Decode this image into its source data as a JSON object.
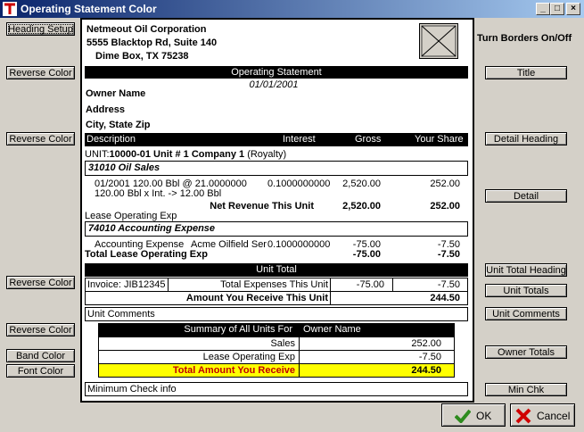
{
  "window": {
    "title": "Operating Statement Color"
  },
  "left_buttons": {
    "heading_setup": "Heading Setup",
    "reverse_color_1": "Reverse Color",
    "reverse_color_2": "Reverse Color",
    "reverse_color_3": "Reverse Color",
    "reverse_color_4": "Reverse Color",
    "band_color": "Band Color",
    "font_color": "Font Color"
  },
  "right_panel": {
    "heading": "Turn Borders On/Off",
    "title": "Title",
    "detail_heading": "Detail Heading",
    "detail": "Detail",
    "unit_total_heading": "Unit Total Heading",
    "unit_totals": "Unit Totals",
    "unit_comments": "Unit Comments",
    "owner_totals": "Owner Totals",
    "min_chk": "Min Chk"
  },
  "company": {
    "name": "Netmeout Oil Corporation",
    "address1": "5555 Blacktop Rd, Suite 140",
    "address2": "Dime Box, TX  75238"
  },
  "statement": {
    "title": "Operating Statement",
    "date": "01/01/2001"
  },
  "owner": {
    "name": "Owner Name",
    "address": "Address",
    "city": "City, State Zip"
  },
  "detail_header": {
    "description": "Description",
    "interest": "Interest",
    "gross": "Gross",
    "share": "Your Share"
  },
  "unit_line": {
    "prefix": "UNIT:",
    "name": "10000-01 Unit # 1 Company 1",
    "suffix": "(Royalty)"
  },
  "oil_sales": {
    "header": "31010 Oil Sales",
    "line1_desc": "01/2001  120.00 Bbl @ 21.0000000",
    "line1_interest": "0.1000000000",
    "line1_gross": "2,520.00",
    "line1_share": "252.00",
    "line2_desc": "120.00 Bbl x Int. -> 12.00 Bbl",
    "net_label": "Net Revenue This Unit",
    "net_gross": "2,520.00",
    "net_share": "252.00"
  },
  "lease_exp": {
    "label": "Lease Operating Exp",
    "header": "74010 Accounting Expense",
    "line1_desc": "Accounting Expense",
    "line1_vendor": "Acme Oilfield Ser",
    "line1_interest": "0.1000000000",
    "line1_gross": "-75.00",
    "line1_share": "-7.50",
    "total_label": "Total Lease Operating Exp",
    "total_gross": "-75.00",
    "total_share": "-7.50"
  },
  "unit_total": {
    "header": "Unit Total",
    "invoice": "Invoice: JIB12345",
    "expenses_label": "Total Expenses This Unit",
    "expenses_gross": "-75.00",
    "expenses_share": "-7.50",
    "receive_label": "Amount You Receive This Unit",
    "receive_value": "244.50"
  },
  "unit_comments": "Unit Comments",
  "summary": {
    "header_label": "Summary of All Units For",
    "header_owner": "Owner Name",
    "sales_label": "Sales",
    "sales_value": "252.00",
    "lease_label": "Lease Operating Exp",
    "lease_value": "-7.50",
    "total_label": "Total Amount You Receive",
    "total_value": "244.50"
  },
  "min_check": "Minimum Check info",
  "actions": {
    "ok": "OK",
    "cancel": "Cancel"
  },
  "colors": {
    "title_bar": "#0a246a",
    "highlight": "#ffff00",
    "bar": "#000000"
  }
}
